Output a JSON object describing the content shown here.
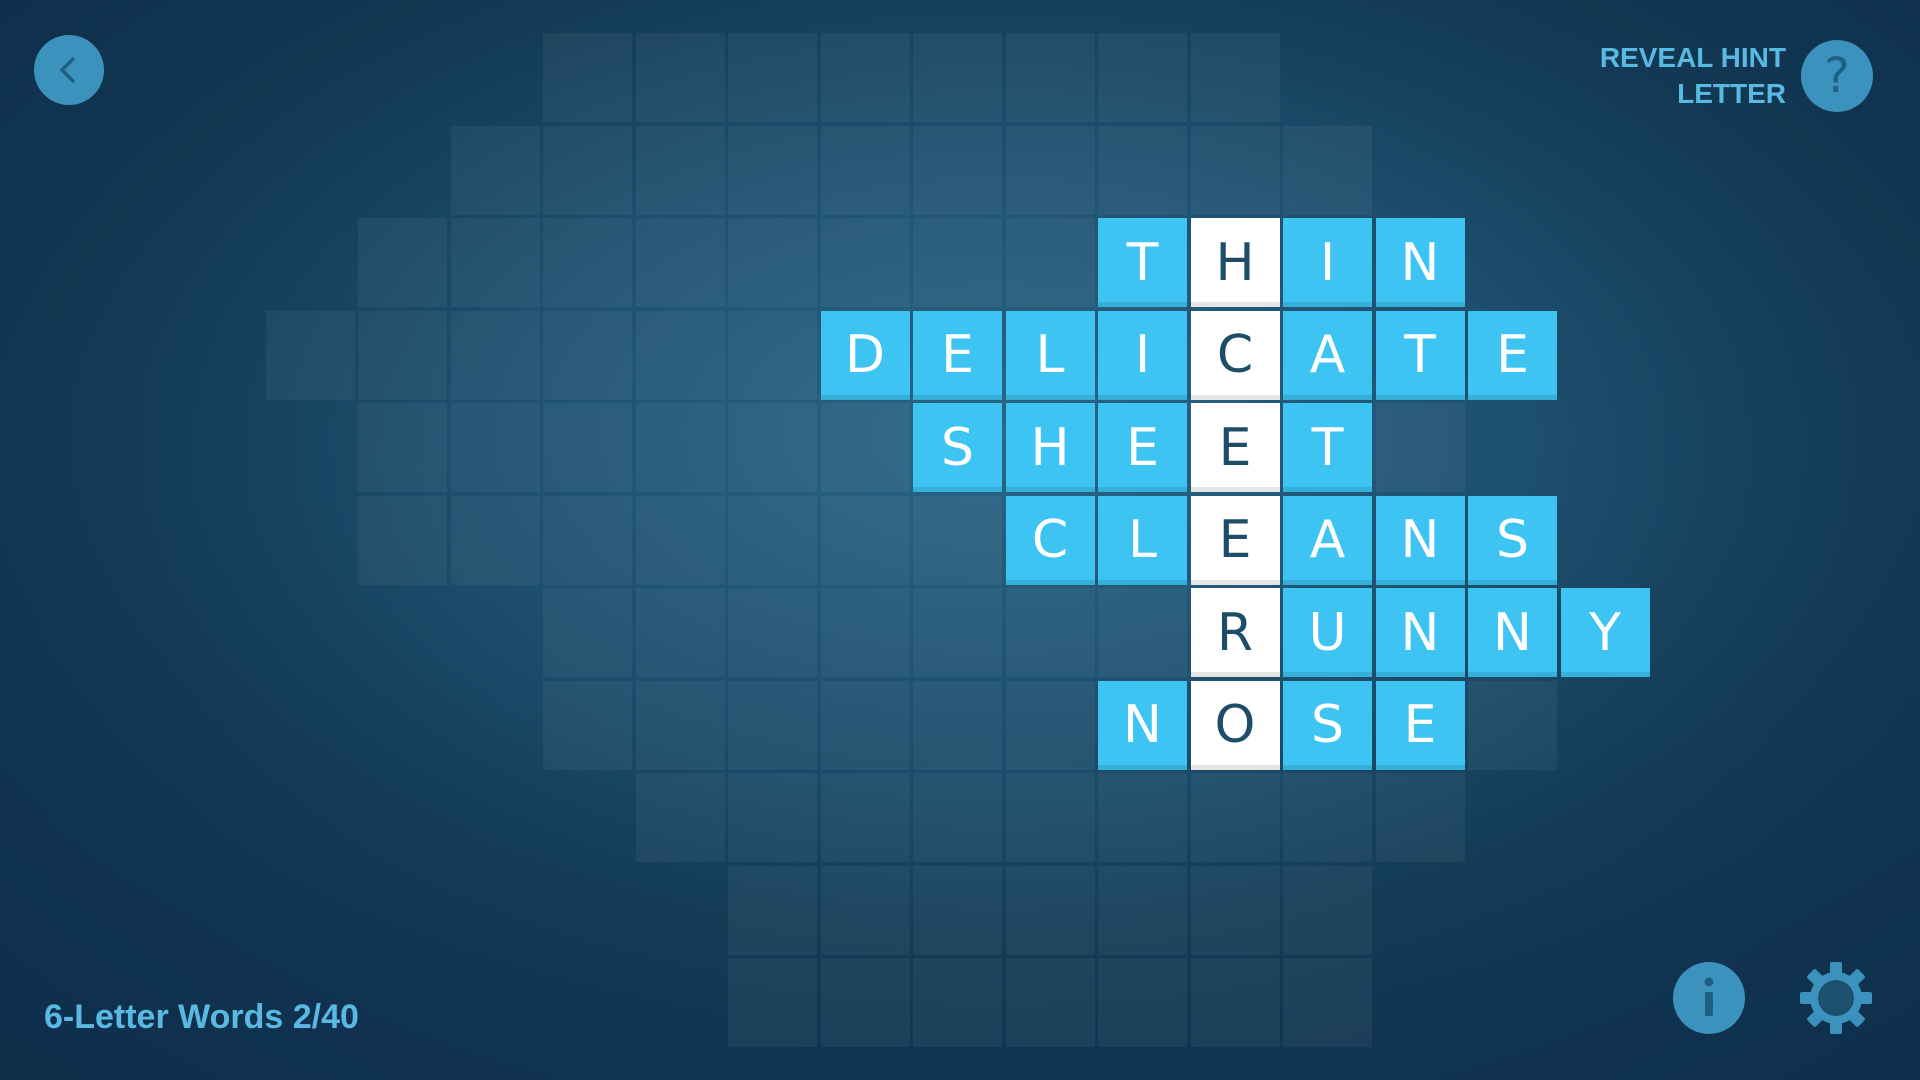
{
  "header": {
    "back_icon": "chevron-left-icon",
    "reveal_hint": {
      "line1": "REVEAL HINT",
      "line2": "LETTER",
      "icon_text": "?"
    }
  },
  "footer": {
    "level_label": "6-Letter Words 2/40",
    "info_icon": "info-icon",
    "settings_icon": "gear-icon"
  },
  "puzzle": {
    "hidden_word": "HCEERO",
    "words": [
      {
        "text": "THIN",
        "row": 2,
        "col": 6
      },
      {
        "text": "DELICATE",
        "row": 3,
        "col": 3
      },
      {
        "text": "SHEET",
        "row": 4,
        "col": 4
      },
      {
        "text": "CLEANS",
        "row": 5,
        "col": 5
      },
      {
        "text": "RUNNY",
        "row": 6,
        "col": 7
      },
      {
        "text": "NOSE",
        "row": 7,
        "col": 6
      }
    ],
    "highlight_col": 7
  },
  "colors": {
    "tile": "#3ec4f2",
    "tile_text": "#ffffff",
    "highlight_tile": "#ffffff",
    "highlight_text": "#1d4d69",
    "accent": "#5ab9e3",
    "button": "#3b93bd"
  }
}
